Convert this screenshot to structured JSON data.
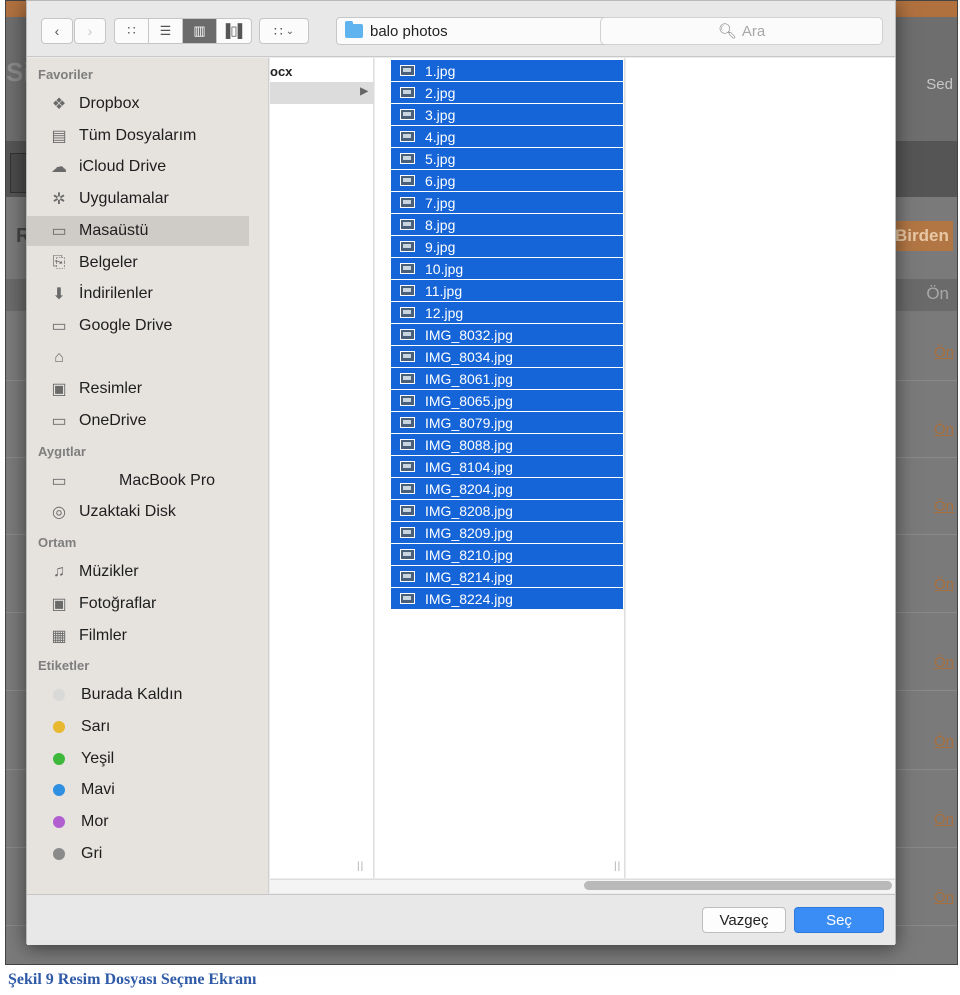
{
  "background": {
    "brand_fragment": "Sis",
    "user_fragment": "Sed",
    "r_fragment": "R",
    "birden_label": "Birden",
    "on_header": "Ön",
    "on_link": "Ön"
  },
  "toolbar": {
    "back_icon": "chevron-left-icon",
    "forward_icon": "chevron-right-icon",
    "path_folder": "balo photos",
    "search_placeholder": "Ara"
  },
  "sidebar": {
    "sections": [
      {
        "title": "Favoriler",
        "items": [
          {
            "label": "Dropbox",
            "icon": "dropbox-icon"
          },
          {
            "label": "Tüm Dosyalarım",
            "icon": "all-files-icon"
          },
          {
            "label": "iCloud Drive",
            "icon": "cloud-icon"
          },
          {
            "label": "Uygulamalar",
            "icon": "applications-icon"
          },
          {
            "label": "Masaüstü",
            "icon": "desktop-icon",
            "selected": true
          },
          {
            "label": "Belgeler",
            "icon": "documents-icon"
          },
          {
            "label": "İndirilenler",
            "icon": "downloads-icon"
          },
          {
            "label": "Google Drive",
            "icon": "folder-icon"
          },
          {
            "label": "",
            "icon": "home-icon"
          },
          {
            "label": "Resimler",
            "icon": "camera-icon"
          },
          {
            "label": "OneDrive",
            "icon": "folder-icon"
          }
        ]
      },
      {
        "title": "Aygıtlar",
        "items": [
          {
            "label": "MacBook Pro",
            "icon": "laptop-icon"
          },
          {
            "label": "Uzaktaki Disk",
            "icon": "disc-icon"
          }
        ]
      },
      {
        "title": "Ortam",
        "items": [
          {
            "label": "Müzikler",
            "icon": "music-icon"
          },
          {
            "label": "Fotoğraflar",
            "icon": "camera-icon"
          },
          {
            "label": "Filmler",
            "icon": "film-icon"
          }
        ]
      },
      {
        "title": "Etiketler",
        "items": [
          {
            "label": "Burada Kaldın",
            "color": "#d9d9d9"
          },
          {
            "label": "Sarı",
            "color": "#e8b830"
          },
          {
            "label": "Yeşil",
            "color": "#3db83a"
          },
          {
            "label": "Mavi",
            "color": "#2f8fe0"
          },
          {
            "label": "Mor",
            "color": "#b05ed0"
          },
          {
            "label": "Gri",
            "color": "#8a8a8a"
          }
        ]
      }
    ]
  },
  "columns": {
    "col1": [
      {
        "label": "ocx",
        "selected": false
      },
      {
        "label": "",
        "selected": true
      }
    ],
    "files": [
      "1.jpg",
      "2.jpg",
      "3.jpg",
      "4.jpg",
      "5.jpg",
      "6.jpg",
      "7.jpg",
      "8.jpg",
      "9.jpg",
      "10.jpg",
      "11.jpg",
      "12.jpg",
      "IMG_8032.jpg",
      "IMG_8034.jpg",
      "IMG_8061.jpg",
      "IMG_8065.jpg",
      "IMG_8079.jpg",
      "IMG_8088.jpg",
      "IMG_8104.jpg",
      "IMG_8204.jpg",
      "IMG_8208.jpg",
      "IMG_8209.jpg",
      "IMG_8210.jpg",
      "IMG_8214.jpg",
      "IMG_8224.jpg"
    ]
  },
  "footer": {
    "cancel_label": "Vazgeç",
    "ok_label": "Seç"
  },
  "caption": "Şekil 9 Resim Dosyası Seçme Ekranı"
}
